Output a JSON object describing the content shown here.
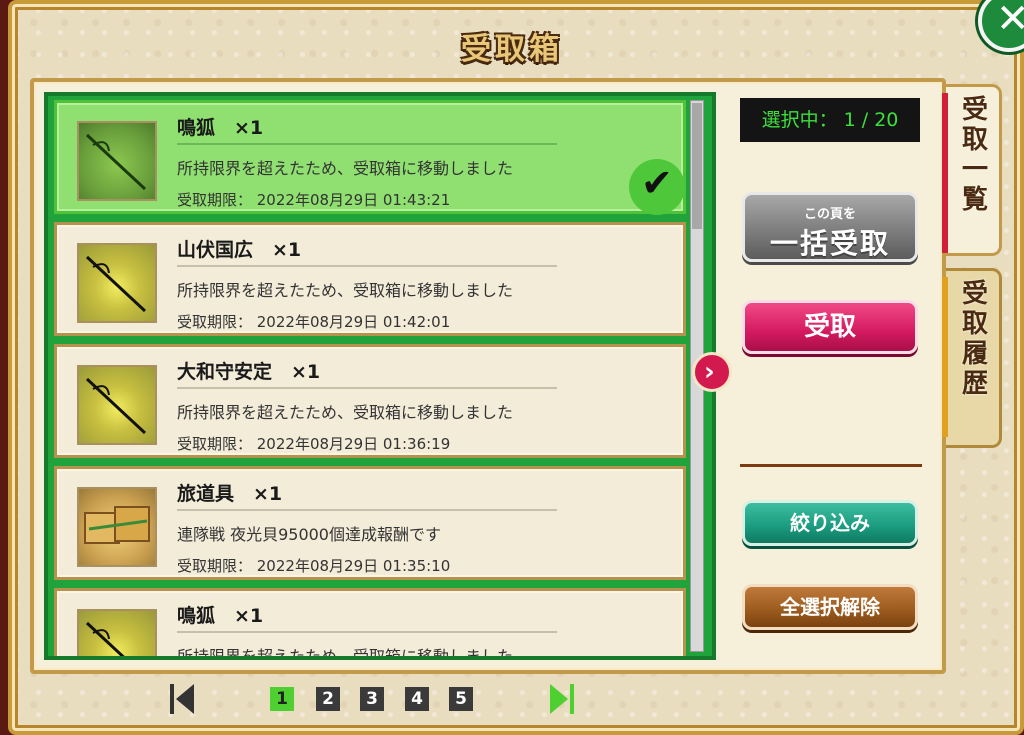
{
  "title": "受取箱",
  "counter": "選択中： 1 / 20",
  "tabs": [
    {
      "label": "受取一覧",
      "active": true
    },
    {
      "label": "受取履歴",
      "active": false
    }
  ],
  "buttons": {
    "bulk_small": "この頁を",
    "bulk_big": "一括受取",
    "receive": "受取",
    "filter": "絞り込み",
    "clear": "全選択解除"
  },
  "items": [
    {
      "name": "鳴狐　×1",
      "desc": "所持限界を超えたため、受取箱に移動しました",
      "expiry": "受取期限： 2022年08月29日 01:43:21",
      "selected": true,
      "icon": "sword-icon"
    },
    {
      "name": "山伏国広　×1",
      "desc": "所持限界を超えたため、受取箱に移動しました",
      "expiry": "受取期限： 2022年08月29日 01:42:01",
      "selected": false,
      "icon": "sword-icon"
    },
    {
      "name": "大和守安定　×1",
      "desc": "所持限界を超えたため、受取箱に移動しました",
      "expiry": "受取期限： 2022年08月29日 01:36:19",
      "selected": false,
      "icon": "sword-icon"
    },
    {
      "name": "旅道具　×1",
      "desc": "連隊戦 夜光貝95000個達成報酬です",
      "expiry": "受取期限： 2022年08月29日 01:35:10",
      "selected": false,
      "icon": "travel-pack-icon"
    },
    {
      "name": "鳴狐　×1",
      "desc": "所持限界を超えたため、受取箱に移動しました",
      "expiry": "",
      "selected": false,
      "icon": "sword-icon"
    }
  ],
  "pagination": {
    "pages": [
      "1",
      "2",
      "3",
      "4",
      "5"
    ],
    "current": "1"
  },
  "colors": {
    "list_bg": "#21a33c",
    "selected_item": "#8fe070",
    "receive_button": "#d41a60",
    "counter_text": "#3be03b"
  }
}
